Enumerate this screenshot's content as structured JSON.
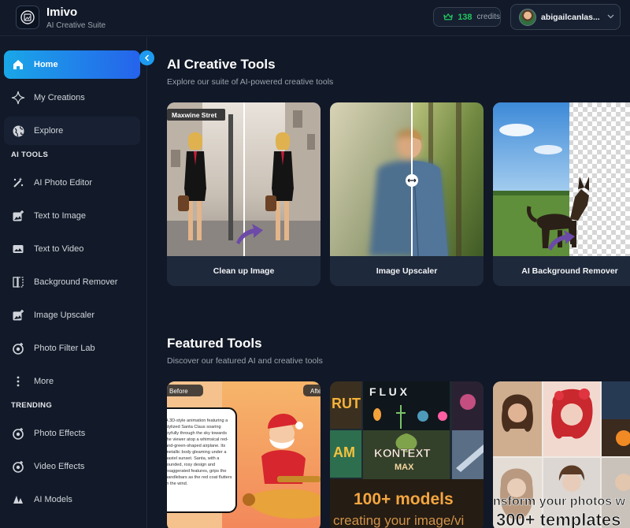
{
  "app": {
    "name": "Imivo",
    "subtitle": "AI Creative Suite"
  },
  "header": {
    "credits_value": "138",
    "credits_label": "credits",
    "username": "abigailcanlas..."
  },
  "sidebar": {
    "items_top": [
      {
        "label": "Home",
        "icon": "home-icon"
      },
      {
        "label": "My Creations",
        "icon": "sparkle-icon"
      },
      {
        "label": "Explore",
        "icon": "globe-icon"
      }
    ],
    "ai_tools_label": "AI TOOLS",
    "ai_tools": [
      {
        "label": "AI Photo Editor",
        "icon": "magic-wand-icon"
      },
      {
        "label": "Text to Image",
        "icon": "image-plus-icon"
      },
      {
        "label": "Text to Video",
        "icon": "video-icon"
      },
      {
        "label": "Background Remover",
        "icon": "split-icon"
      },
      {
        "label": "Image Upscaler",
        "icon": "image-plus-icon"
      },
      {
        "label": "Photo Filter Lab",
        "icon": "filter-icon"
      },
      {
        "label": "More",
        "icon": "more-vertical-icon"
      }
    ],
    "trending_label": "TRENDING",
    "trending": [
      {
        "label": "Photo Effects",
        "icon": "filter-icon"
      },
      {
        "label": "Video Effects",
        "icon": "filter-icon"
      },
      {
        "label": "AI Models",
        "icon": "layers-icon"
      }
    ]
  },
  "main": {
    "creative": {
      "title": "AI Creative Tools",
      "subtitle": "Explore our suite of AI-powered creative tools",
      "cards": [
        {
          "label": "Clean up Image",
          "street_sign": "Maxwine Stret"
        },
        {
          "label": "Image Upscaler"
        },
        {
          "label": "AI Background Remover"
        }
      ]
    },
    "featured": {
      "title": "Featured Tools",
      "subtitle": "Discover our featured AI and creative tools",
      "card1": {
        "before": "Before",
        "after": "After",
        "text": "A 3D-style animation featuring a stylized Santa Claus soaring joyfully through the sky towards the viewer atop a whimsical red-and-green-shaped airplane. Its metallic body gleaming under a pastel sunset. Santa, with a rounded, rosy design and exaggerated features, grips the handlebars as the red coat flutters in the wind."
      },
      "card2": {
        "flux": "F  L  U  X",
        "kontext": "KONTEXT",
        "max": "MAX",
        "headline": "100+ models",
        "sub": "creating your image/vi"
      },
      "card3": {
        "headline": "nsform your photos w",
        "sub": "300+ templates"
      }
    }
  },
  "colors": {
    "accent": "#1d9bf0",
    "credits": "#22c55e",
    "bg": "#111827",
    "sidebar": "#121a29",
    "card": "#1e293b"
  }
}
